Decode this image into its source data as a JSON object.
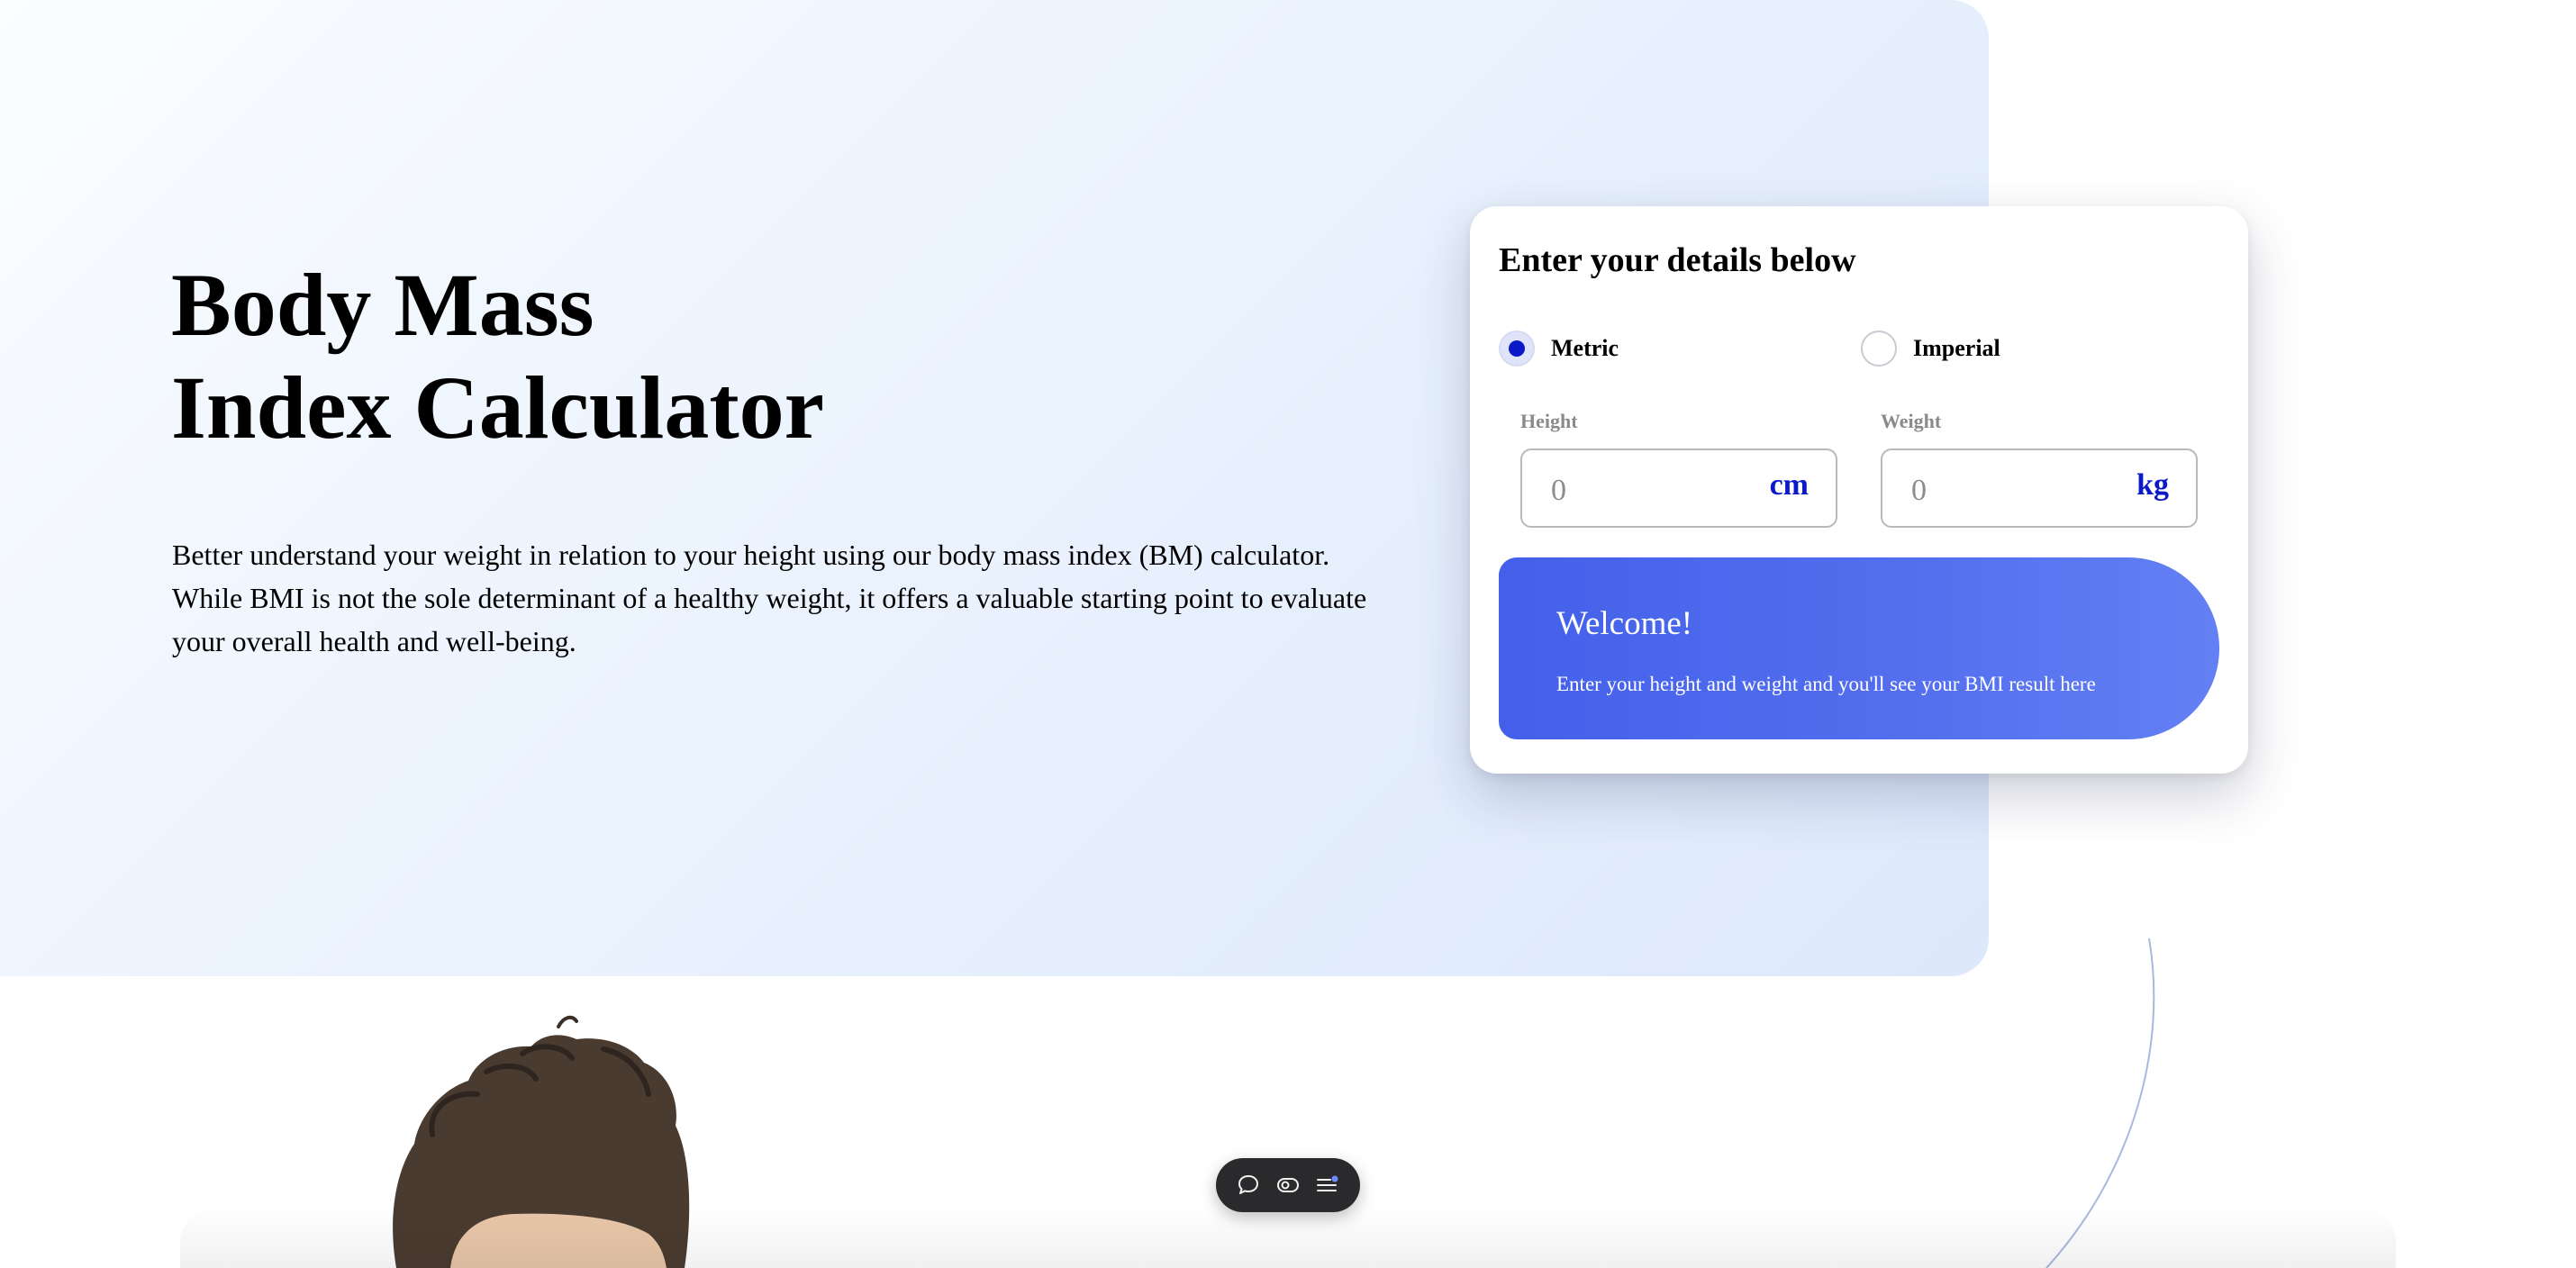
{
  "hero": {
    "title_line1": "Body Mass",
    "title_line2": "Index Calculator",
    "description": "Better understand your weight in relation to your height using our body mass index (BM) calculator. While BMI is not the sole determinant of a healthy weight, it offers a valuable starting point to evaluate your overall health and well-being."
  },
  "calculator": {
    "heading": "Enter your details below",
    "units": {
      "options": [
        "Metric",
        "Imperial"
      ],
      "selected": "Metric"
    },
    "height": {
      "label": "Height",
      "placeholder": "0",
      "unit": "cm"
    },
    "weight": {
      "label": "Weight",
      "placeholder": "0",
      "unit": "kg"
    },
    "result": {
      "title": "Welcome!",
      "message": "Enter your height and weight and you'll see your BMI result here"
    }
  },
  "toolbar": {
    "icons": [
      "comment-icon",
      "toggle-view-icon",
      "menu-icon"
    ]
  },
  "colors": {
    "accent": "#0b19c9",
    "result_gradient_start": "#4460ea",
    "result_gradient_end": "#6380f4",
    "toolbar_bg": "#2a2a2c"
  }
}
